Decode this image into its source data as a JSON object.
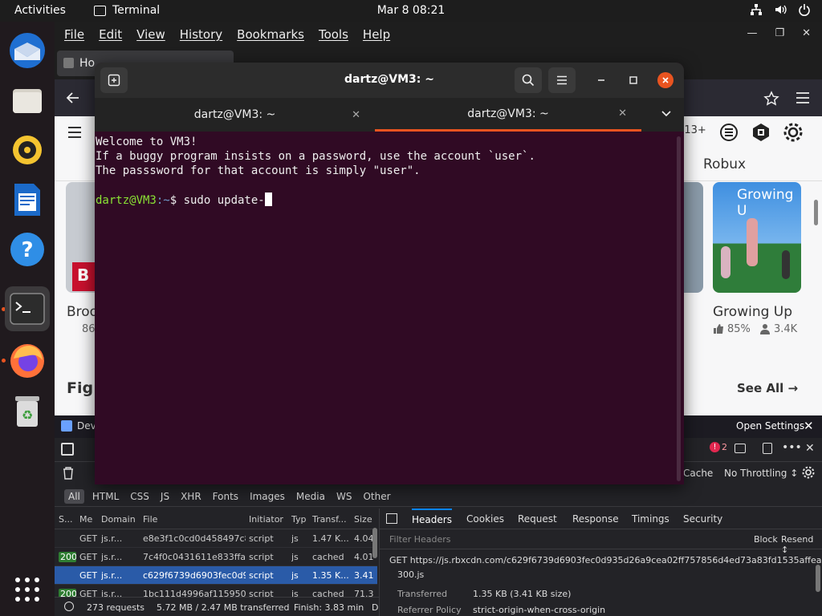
{
  "topbar": {
    "activities": "Activities",
    "app_name": "Terminal",
    "clock": "Mar 8  08:21"
  },
  "dock": {
    "items": [
      "thunderbird-icon",
      "files-icon",
      "rhythmbox-icon",
      "writer-icon",
      "help-icon",
      "terminal-icon",
      "firefox-icon",
      "trash-icon",
      "apps-grid-icon"
    ]
  },
  "firefox": {
    "menu": [
      "File",
      "Edit",
      "View",
      "History",
      "Bookmarks",
      "Tools",
      "Help"
    ],
    "tab_label": "Ho",
    "content": {
      "rating_badge": "d 13+",
      "robux": "Robux",
      "banner_text": "Growing U",
      "card_left_title": "Broo",
      "card_left_stat": "86",
      "card_right_title": "Growing Up",
      "card_right_rating": "85%",
      "card_right_players": "3.4K",
      "section_title": "Fig",
      "see_all": "See All →"
    },
    "devtools": {
      "tab_label": "Dev",
      "open_settings": "Open Settings",
      "error_count": "2",
      "cache": "Cache",
      "throttling": "No Throttling ↕",
      "filters": [
        "All",
        "HTML",
        "CSS",
        "JS",
        "XHR",
        "Fonts",
        "Images",
        "Media",
        "WS",
        "Other"
      ],
      "columns": [
        "S...",
        "Me",
        "Domain",
        "File",
        "Initiator",
        "Typ",
        "Transf...",
        "Size"
      ],
      "rows": [
        {
          "status": "",
          "method": "GET",
          "domain": "js.r...",
          "file": "e8e3f1c0cd0d458497c8",
          "initiator": "script",
          "type": "js",
          "transferred": "1.47 K...",
          "size": "4.04"
        },
        {
          "status": "200",
          "method": "GET",
          "domain": "js.r...",
          "file": "7c4f0c0431611e833ffa0e",
          "initiator": "script",
          "type": "js",
          "transferred": "cached",
          "size": "4.01"
        },
        {
          "status": "",
          "method": "GET",
          "domain": "js.r...",
          "file": "c629f6739d6903fec0d93",
          "initiator": "script",
          "type": "js",
          "transferred": "1.35 K...",
          "size": "3.41"
        },
        {
          "status": "200",
          "method": "GET",
          "domain": "js.r...",
          "file": "1bc111d4996af11595011",
          "initiator": "script",
          "type": "js",
          "transferred": "cached",
          "size": "71.3"
        }
      ],
      "detail_tabs": [
        "Headers",
        "Cookies",
        "Request",
        "Response",
        "Timings",
        "Security"
      ],
      "filter_headers": "Filter Headers",
      "block": "Block",
      "resend": "Resend ↕",
      "get_url": "GET  https://js.rbxcdn.com/c629f6739d6903fec0d935d26a9cea02ff757856d4ed73a83fd1535affea0",
      "get_url_cont": "300.js",
      "transferred_label": "Transferred",
      "transferred_value": "1.35 KB (3.41 KB size)",
      "referrer_label": "Referrer Policy",
      "referrer_value": "strict-origin-when-cross-origin",
      "summary": {
        "requests": "273 requests",
        "size": "5.72 MB / 2.47 MB transferred",
        "finish": "Finish: 3.83 min",
        "dc": "D"
      }
    }
  },
  "terminal": {
    "title": "dartz@VM3: ~",
    "tabs": [
      "dartz@VM3: ~",
      "dartz@VM3: ~"
    ],
    "lines": [
      "Welcome to VM3!",
      "If a buggy program insists on a password, use the account `user`.",
      "The passsword for that account is simply \"user\"."
    ],
    "prompt_user": "dartz@VM3",
    "prompt_path": ":~",
    "prompt_symbol": "$ ",
    "command": "sudo update-"
  }
}
